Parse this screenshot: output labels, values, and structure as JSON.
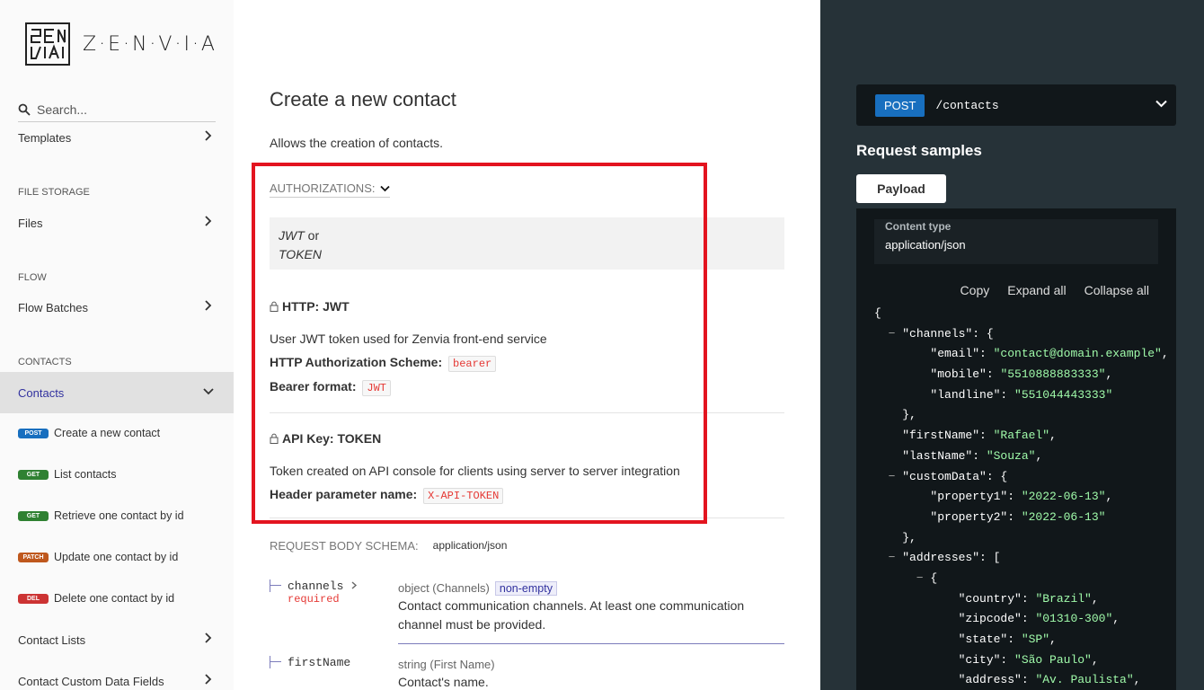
{
  "brand": {
    "wordmark": "Z·E·N·V·I·A"
  },
  "sidebar": {
    "search_placeholder": "Search...",
    "items": [
      {
        "label": "Templates"
      },
      {
        "section": "FILE STORAGE",
        "label": "Files"
      },
      {
        "section": "FLOW",
        "label": "Flow Batches"
      },
      {
        "section": "CONTACTS",
        "label": "Contacts"
      },
      {
        "label": "Contact Lists"
      },
      {
        "label": "Contact Custom Data Fields"
      }
    ],
    "operations": [
      {
        "method": "post",
        "label": "Create a new contact"
      },
      {
        "method": "get",
        "label": "List contacts"
      },
      {
        "method": "get",
        "label": "Retrieve one contact by id"
      },
      {
        "method": "patch",
        "label": "Update one contact by id"
      },
      {
        "method": "del",
        "label": "Delete one contact by id"
      }
    ]
  },
  "main": {
    "title": "Create a new contact",
    "description": "Allows the creation of contacts.",
    "auth_header": "AUTHORIZATIONS:",
    "auth_options": {
      "first": "JWT",
      "or": " or",
      "second": "TOKEN"
    },
    "schemes": [
      {
        "title": "HTTP: JWT",
        "description": "User JWT token used for Zenvia front-end service",
        "rows": [
          {
            "label": "HTTP Authorization Scheme:",
            "value": "bearer"
          },
          {
            "label": "Bearer format:",
            "value": "JWT"
          }
        ]
      },
      {
        "title": "API Key: TOKEN",
        "description": "Token created on API console for clients using server to server integration",
        "rows": [
          {
            "label": "Header parameter name:",
            "value": "X-API-TOKEN"
          }
        ]
      }
    ],
    "schema_header": "REQUEST BODY SCHEMA:",
    "schema_content_type": "application/json",
    "properties": [
      {
        "name": "channels",
        "required": "required",
        "type": "object (Channels)",
        "constraint": "non-empty",
        "description": "Contact communication channels. At least one communication channel must be provided."
      },
      {
        "name": "firstName",
        "type": "string (First Name)",
        "description": "Contact's name."
      }
    ]
  },
  "right": {
    "method": "POST",
    "path": "/contacts",
    "samples_title": "Request samples",
    "tab": "Payload",
    "content_type_label": "Content type",
    "content_type_value": "application/json",
    "controls": {
      "copy": "Copy",
      "expand": "Expand all",
      "collapse": "Collapse all"
    },
    "colors": {
      "string": "#a0fbaa",
      "panel": "#263238",
      "highlight": "#e3141f"
    }
  }
}
